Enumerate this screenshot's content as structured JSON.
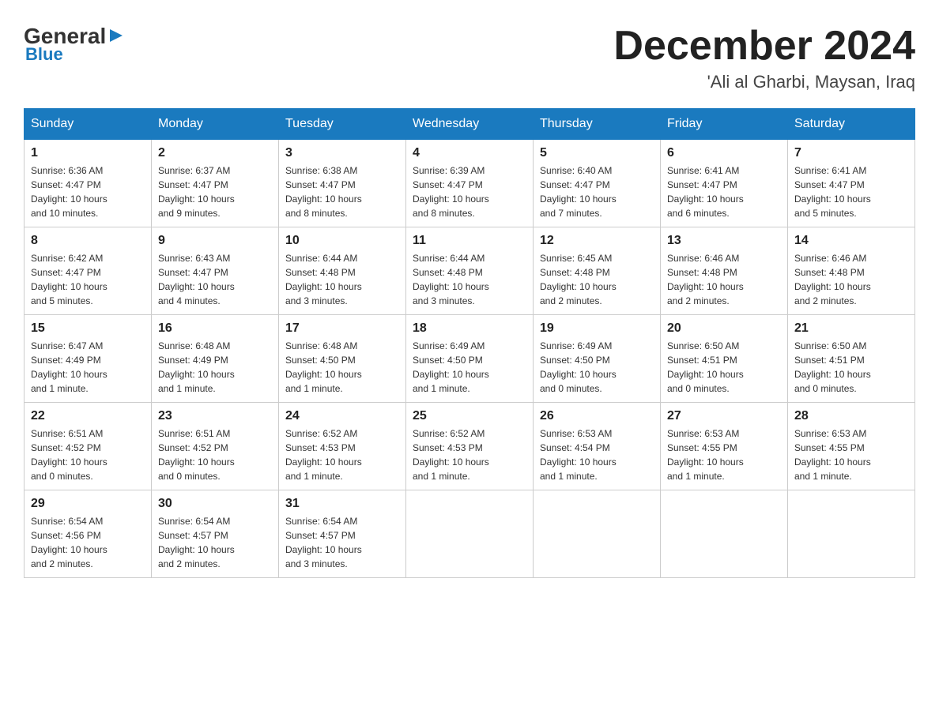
{
  "logo": {
    "general": "General",
    "blue": "Blue"
  },
  "header": {
    "month": "December 2024",
    "location": "'Ali al Gharbi, Maysan, Iraq"
  },
  "days_of_week": [
    "Sunday",
    "Monday",
    "Tuesday",
    "Wednesday",
    "Thursday",
    "Friday",
    "Saturday"
  ],
  "weeks": [
    [
      {
        "day": "1",
        "sunrise": "6:36 AM",
        "sunset": "4:47 PM",
        "daylight": "10 hours and 10 minutes."
      },
      {
        "day": "2",
        "sunrise": "6:37 AM",
        "sunset": "4:47 PM",
        "daylight": "10 hours and 9 minutes."
      },
      {
        "day": "3",
        "sunrise": "6:38 AM",
        "sunset": "4:47 PM",
        "daylight": "10 hours and 8 minutes."
      },
      {
        "day": "4",
        "sunrise": "6:39 AM",
        "sunset": "4:47 PM",
        "daylight": "10 hours and 8 minutes."
      },
      {
        "day": "5",
        "sunrise": "6:40 AM",
        "sunset": "4:47 PM",
        "daylight": "10 hours and 7 minutes."
      },
      {
        "day": "6",
        "sunrise": "6:41 AM",
        "sunset": "4:47 PM",
        "daylight": "10 hours and 6 minutes."
      },
      {
        "day": "7",
        "sunrise": "6:41 AM",
        "sunset": "4:47 PM",
        "daylight": "10 hours and 5 minutes."
      }
    ],
    [
      {
        "day": "8",
        "sunrise": "6:42 AM",
        "sunset": "4:47 PM",
        "daylight": "10 hours and 5 minutes."
      },
      {
        "day": "9",
        "sunrise": "6:43 AM",
        "sunset": "4:47 PM",
        "daylight": "10 hours and 4 minutes."
      },
      {
        "day": "10",
        "sunrise": "6:44 AM",
        "sunset": "4:48 PM",
        "daylight": "10 hours and 3 minutes."
      },
      {
        "day": "11",
        "sunrise": "6:44 AM",
        "sunset": "4:48 PM",
        "daylight": "10 hours and 3 minutes."
      },
      {
        "day": "12",
        "sunrise": "6:45 AM",
        "sunset": "4:48 PM",
        "daylight": "10 hours and 2 minutes."
      },
      {
        "day": "13",
        "sunrise": "6:46 AM",
        "sunset": "4:48 PM",
        "daylight": "10 hours and 2 minutes."
      },
      {
        "day": "14",
        "sunrise": "6:46 AM",
        "sunset": "4:48 PM",
        "daylight": "10 hours and 2 minutes."
      }
    ],
    [
      {
        "day": "15",
        "sunrise": "6:47 AM",
        "sunset": "4:49 PM",
        "daylight": "10 hours and 1 minute."
      },
      {
        "day": "16",
        "sunrise": "6:48 AM",
        "sunset": "4:49 PM",
        "daylight": "10 hours and 1 minute."
      },
      {
        "day": "17",
        "sunrise": "6:48 AM",
        "sunset": "4:50 PM",
        "daylight": "10 hours and 1 minute."
      },
      {
        "day": "18",
        "sunrise": "6:49 AM",
        "sunset": "4:50 PM",
        "daylight": "10 hours and 1 minute."
      },
      {
        "day": "19",
        "sunrise": "6:49 AM",
        "sunset": "4:50 PM",
        "daylight": "10 hours and 0 minutes."
      },
      {
        "day": "20",
        "sunrise": "6:50 AM",
        "sunset": "4:51 PM",
        "daylight": "10 hours and 0 minutes."
      },
      {
        "day": "21",
        "sunrise": "6:50 AM",
        "sunset": "4:51 PM",
        "daylight": "10 hours and 0 minutes."
      }
    ],
    [
      {
        "day": "22",
        "sunrise": "6:51 AM",
        "sunset": "4:52 PM",
        "daylight": "10 hours and 0 minutes."
      },
      {
        "day": "23",
        "sunrise": "6:51 AM",
        "sunset": "4:52 PM",
        "daylight": "10 hours and 0 minutes."
      },
      {
        "day": "24",
        "sunrise": "6:52 AM",
        "sunset": "4:53 PM",
        "daylight": "10 hours and 1 minute."
      },
      {
        "day": "25",
        "sunrise": "6:52 AM",
        "sunset": "4:53 PM",
        "daylight": "10 hours and 1 minute."
      },
      {
        "day": "26",
        "sunrise": "6:53 AM",
        "sunset": "4:54 PM",
        "daylight": "10 hours and 1 minute."
      },
      {
        "day": "27",
        "sunrise": "6:53 AM",
        "sunset": "4:55 PM",
        "daylight": "10 hours and 1 minute."
      },
      {
        "day": "28",
        "sunrise": "6:53 AM",
        "sunset": "4:55 PM",
        "daylight": "10 hours and 1 minute."
      }
    ],
    [
      {
        "day": "29",
        "sunrise": "6:54 AM",
        "sunset": "4:56 PM",
        "daylight": "10 hours and 2 minutes."
      },
      {
        "day": "30",
        "sunrise": "6:54 AM",
        "sunset": "4:57 PM",
        "daylight": "10 hours and 2 minutes."
      },
      {
        "day": "31",
        "sunrise": "6:54 AM",
        "sunset": "4:57 PM",
        "daylight": "10 hours and 3 minutes."
      },
      null,
      null,
      null,
      null
    ]
  ],
  "labels": {
    "sunrise": "Sunrise:",
    "sunset": "Sunset:",
    "daylight": "Daylight:"
  }
}
